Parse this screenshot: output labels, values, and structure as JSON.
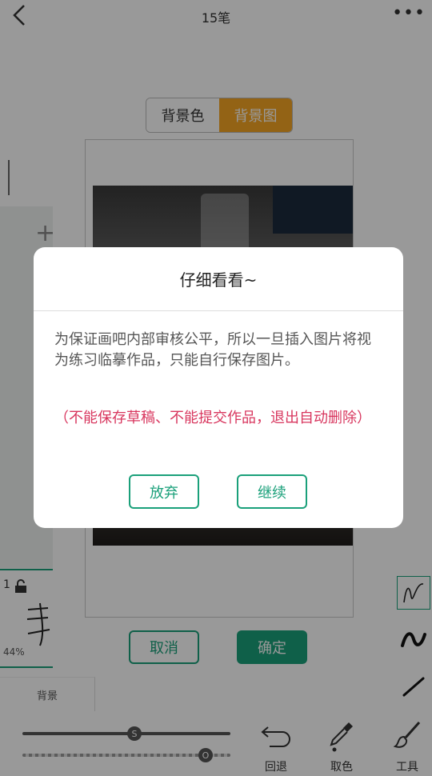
{
  "header": {
    "title": "15笔"
  },
  "segment": {
    "color_label": "背景色",
    "image_label": "背景图"
  },
  "canvas_actions": {
    "cancel": "取消",
    "confirm": "确定"
  },
  "layer": {
    "number": "1",
    "percent": "44%",
    "bg_label": "背景"
  },
  "tools": {
    "undo": "回退",
    "pick_color": "取色",
    "tools": "工具"
  },
  "sliders": {
    "size_knob": "S",
    "opacity_knob": "O"
  },
  "dialog": {
    "title": "仔细看看~",
    "body": "为保证画吧内部审核公平，所以一旦插入图片将视为练习临摹作品，只能自行保存图片。",
    "warning": "（不能保存草稿、不能提交作品，退出自动删除）",
    "abandon": "放弃",
    "continue": "继续"
  },
  "colors": {
    "accent": "#1aa07a",
    "segment_active": "#f5a623",
    "warning": "#d8365e"
  }
}
